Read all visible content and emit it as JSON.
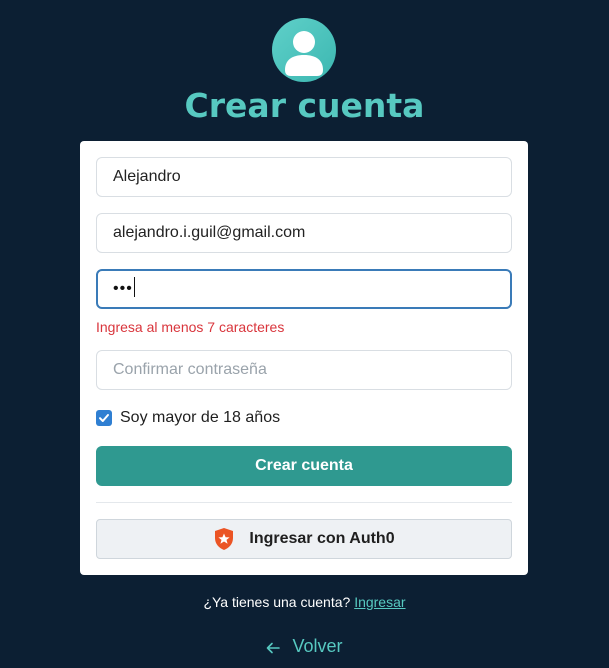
{
  "header": {
    "title": "Crear cuenta",
    "avatar_icon": "user-avatar-icon"
  },
  "form": {
    "name": {
      "value": "Alejandro"
    },
    "email": {
      "value": "alejandro.i.guil@gmail.com"
    },
    "password": {
      "value_masked": "•••",
      "focused": true
    },
    "password_error": "Ingresa al menos 7 caracteres",
    "confirm_password": {
      "value": "",
      "placeholder": "Confirmar contraseña"
    },
    "age_checkbox": {
      "label": "Soy mayor de 18 años",
      "checked": true
    },
    "submit_label": "Crear cuenta",
    "auth0_label": "Ingresar con Auth0"
  },
  "footer": {
    "signin_text": "¿Ya tienes una cuenta?",
    "signin_link": "Ingresar",
    "back_label": "Volver"
  },
  "colors": {
    "background": "#0c1f33",
    "accent": "#57c9c1",
    "primary_button": "#2f9990",
    "error": "#d9353c",
    "checkbox": "#2f7fd2",
    "auth0_brand": "#eb5424"
  }
}
